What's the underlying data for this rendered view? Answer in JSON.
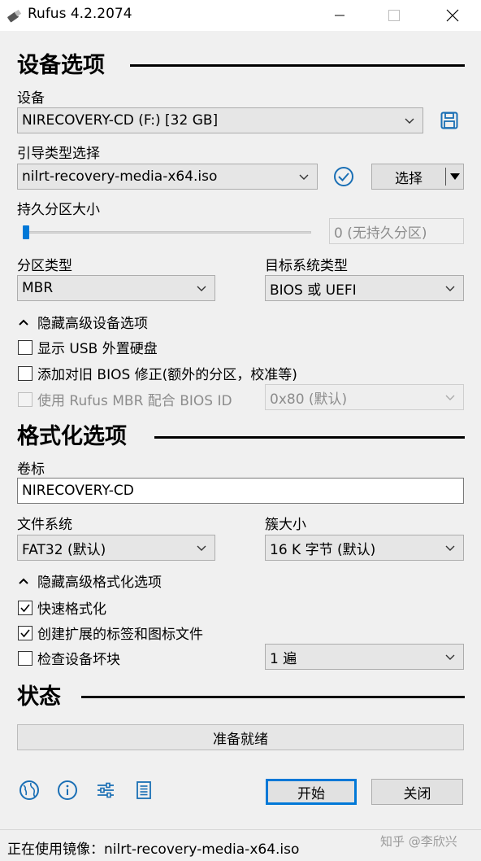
{
  "window": {
    "title": "Rufus 4.2.2074",
    "minimize_icon": "minimize-icon",
    "maximize_icon": "maximize-icon",
    "close_icon": "close-icon"
  },
  "device_section": {
    "title": "设备选项",
    "device_label": "设备",
    "device_value": "NIRECOVERY-CD (F:) [32 GB]",
    "boot_label": "引导类型选择",
    "boot_value": "nilrt-recovery-media-x64.iso",
    "select_button": "选择",
    "persistent_label": "持久分区大小",
    "persistent_value": "0 (无持久分区)",
    "persistent_level": 0,
    "partition_label": "分区类型",
    "partition_value": "MBR",
    "target_label": "目标系统类型",
    "target_value": "BIOS 或 UEFI",
    "advanced_toggle": "隐藏高级设备选项",
    "show_usb_hdd": "显示 USB 外置硬盘",
    "old_bios_fix": "添加对旧 BIOS 修正(额外的分区，校准等)",
    "rufus_mbr": "使用 Rufus MBR 配合 BIOS ID",
    "bios_id_value": "0x80 (默认)"
  },
  "format_section": {
    "title": "格式化选项",
    "volume_label": "卷标",
    "volume_value": "NIRECOVERY-CD",
    "fs_label": "文件系统",
    "fs_value": "FAT32 (默认)",
    "cluster_label": "簇大小",
    "cluster_value": "16 K 字节 (默认)",
    "advanced_toggle": "隐藏高级格式化选项",
    "quick_format": "快速格式化",
    "extended_label": "创建扩展的标签和图标文件",
    "bad_blocks": "检查设备坏块",
    "passes_value": "1 遍"
  },
  "status_section": {
    "title": "状态",
    "status_text": "准备就绪"
  },
  "bottom": {
    "start_button": "开始",
    "close_button": "关闭"
  },
  "statusbar": {
    "text": "正在使用镜像：nilrt-recovery-media-x64.iso",
    "watermark": "知乎 @李欣兴"
  },
  "colors": {
    "accent": "#0078d7",
    "icon_blue": "#1a6fb5"
  }
}
